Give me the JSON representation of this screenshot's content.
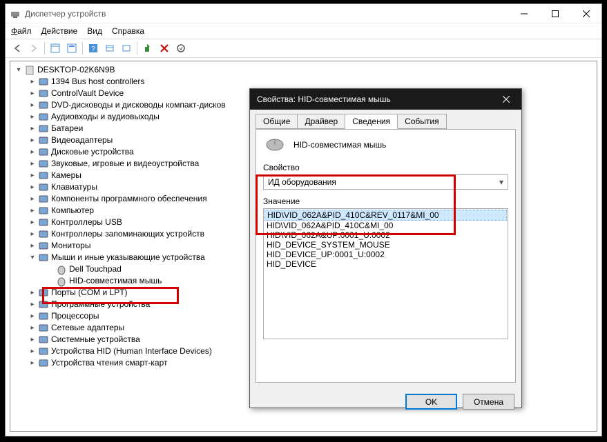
{
  "mainWindow": {
    "title": "Диспетчер устройств",
    "menu": {
      "file": "Файл",
      "action": "Действие",
      "view": "Вид",
      "help": "Справка"
    }
  },
  "tree": {
    "root": "DESKTOP-02K6N9B",
    "categories": [
      "1394 Bus host controllers",
      "ControlVault Device",
      "DVD-дисководы и дисководы компакт-дисков",
      "Аудиовходы и аудиовыходы",
      "Батареи",
      "Видеоадаптеры",
      "Дисковые устройства",
      "Звуковые, игровые и видеоустройства",
      "Камеры",
      "Клавиатуры",
      "Компоненты программного обеспечения",
      "Компьютер",
      "Контроллеры USB",
      "Контроллеры запоминающих устройств",
      "Мониторы",
      "Мыши и иные указывающие устройства",
      "Порты (COM и LPT)",
      "Программные устройства",
      "Процессоры",
      "Сетевые адаптеры",
      "Системные устройства",
      "Устройства HID (Human Interface Devices)",
      "Устройства чтения смарт-карт"
    ],
    "mice_children": [
      "Dell Touchpad",
      "HID-совместимая мышь"
    ]
  },
  "dialog": {
    "title": "Свойства: HID-совместимая мышь",
    "tabs": {
      "general": "Общие",
      "driver": "Драйвер",
      "details": "Сведения",
      "events": "События"
    },
    "deviceName": "HID-совместимая мышь",
    "propertyLabel": "Свойство",
    "propertySelected": "ИД оборудования",
    "valueLabel": "Значение",
    "values": [
      "HID\\VID_062A&PID_410C&REV_0117&MI_00",
      "HID\\VID_062A&PID_410C&MI_00",
      "HID\\VID_062A&UP:0001_U:0002",
      "HID_DEVICE_SYSTEM_MOUSE",
      "HID_DEVICE_UP:0001_U:0002",
      "HID_DEVICE"
    ],
    "buttons": {
      "ok": "OK",
      "cancel": "Отмена"
    }
  }
}
